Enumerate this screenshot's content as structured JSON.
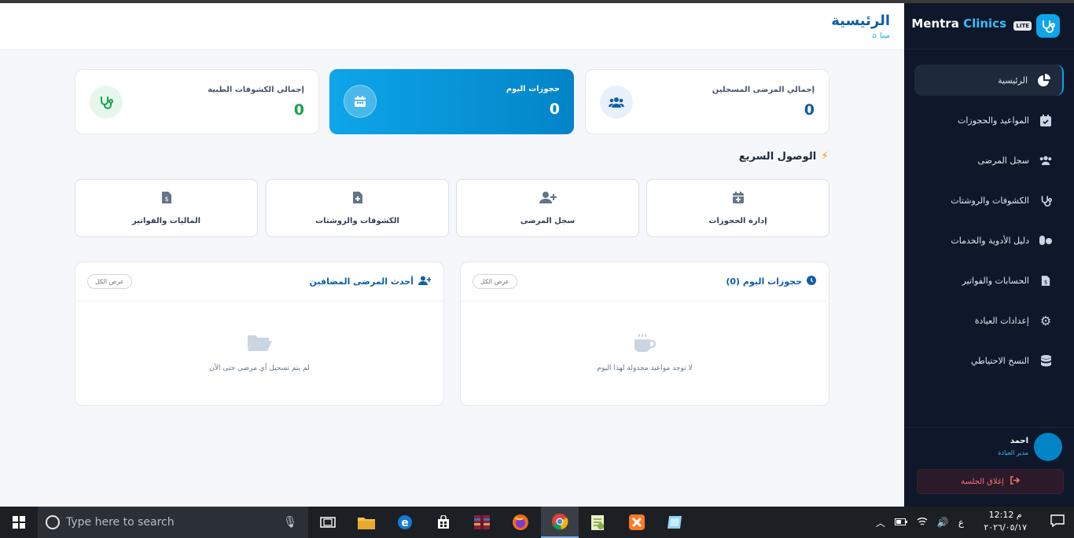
{
  "brand": {
    "name_part1": "Mentra",
    "name_part2": "Clinics",
    "badge": "LITE"
  },
  "header": {
    "title": "الرئيسية",
    "breadcrumb": "مينا"
  },
  "stats": [
    {
      "title": "إجمالي المرضى المسجلين",
      "value": "0"
    },
    {
      "title": "حجوزات اليوم",
      "value": "0"
    },
    {
      "title": "إجمالي الكشوفات الطبية",
      "value": "0"
    }
  ],
  "quick_access": {
    "title": "الوصول السريع",
    "items": [
      {
        "label": "إدارة الحجوزات"
      },
      {
        "label": "سجل المرضى"
      },
      {
        "label": "الكشوفات والروشتات"
      },
      {
        "label": "الماليات والفواتير"
      }
    ]
  },
  "panels": {
    "today": {
      "title": "حجوزات اليوم (0)",
      "view_all": "عرض الكل",
      "empty": "لا توجد مواعيد مجدولة لهذا اليوم"
    },
    "patients": {
      "title": "أحدث المرضى المضافين",
      "view_all": "عرض الكل",
      "empty": "لم يتم تسجيل أي مرضى حتى الآن"
    }
  },
  "sidebar": {
    "items": [
      {
        "label": "الرئيسية",
        "icon": "pie-chart-icon"
      },
      {
        "label": "المواعيد والحجوزات",
        "icon": "calendar-check-icon"
      },
      {
        "label": "سجل المرضى",
        "icon": "users-icon"
      },
      {
        "label": "الكشوفات والروشتات",
        "icon": "stethoscope-icon"
      },
      {
        "label": "دليل الأدوية والخدمات",
        "icon": "pills-icon"
      },
      {
        "label": "الحسابات والفواتير",
        "icon": "invoice-icon"
      },
      {
        "label": "إعدادات العيادة",
        "icon": "gear-icon"
      },
      {
        "label": "النسخ الاحتياطي",
        "icon": "database-icon"
      }
    ],
    "user": {
      "name": "احمد",
      "role": "مدير العيادة"
    },
    "logout": "إغلاق الجلسة"
  },
  "taskbar": {
    "search_placeholder": "Type here to search",
    "time": "12:12 م",
    "date": "٢٠٢٦/٠٥/١٧",
    "lang": "ع"
  },
  "colors": {
    "primary": "#0ea5e9",
    "sidebar": "#0f172a",
    "title": "#0f5ea8",
    "success": "#16a34a"
  }
}
